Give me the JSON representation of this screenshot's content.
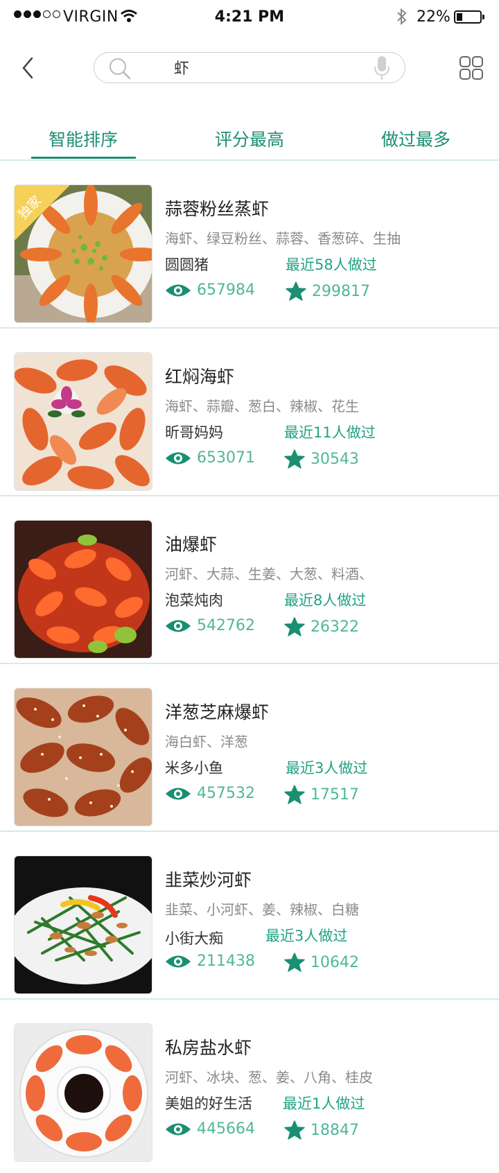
{
  "status_bar": {
    "carrier": "VIRGIN",
    "time": "4:21 PM",
    "battery": "22%",
    "battery_level": 0.22
  },
  "search": {
    "query": "虾"
  },
  "tabs": [
    {
      "label": "智能排序",
      "active": true
    },
    {
      "label": "评分最高",
      "active": false
    },
    {
      "label": "做过最多",
      "active": false
    }
  ],
  "colors": {
    "accent": "#1a8f72",
    "accent_light": "#4fb79a",
    "badge": "#f6d15a"
  },
  "recipes": [
    {
      "title": "蒜蓉粉丝蒸虾",
      "ingredients": "海虾、绿豆粉丝、蒜蓉、香葱碎、生抽",
      "author": "圆圆猪",
      "made": "最近58人做过",
      "views": "657984",
      "stars": "299817",
      "badge": "独家"
    },
    {
      "title": "红焖海虾",
      "ingredients": "海虾、蒜瓣、葱白、辣椒、花生",
      "author": "昕哥妈妈",
      "made": "最近11人做过",
      "views": "653071",
      "stars": "30543"
    },
    {
      "title": "油爆虾",
      "ingredients": "河虾、大蒜、生姜、大葱、料酒、",
      "author": "泡菜炖肉",
      "made": "最近8人做过",
      "views": "542762",
      "stars": "26322"
    },
    {
      "title": "洋葱芝麻爆虾",
      "ingredients": "海白虾、洋葱",
      "author": "米多小鱼",
      "made": "最近3人做过",
      "views": "457532",
      "stars": "17517"
    },
    {
      "title": "韭菜炒河虾",
      "ingredients": "韭菜、小河虾、姜、辣椒、白糖",
      "author": "小街大痴",
      "made": "最近3人做过",
      "views": "211438",
      "stars": "10642"
    },
    {
      "title": "私房盐水虾",
      "ingredients": "河虾、冰块、葱、姜、八角、桂皮",
      "author": "美姐的好生活",
      "made": "最近1人做过",
      "views": "445664",
      "stars": "18847"
    }
  ]
}
